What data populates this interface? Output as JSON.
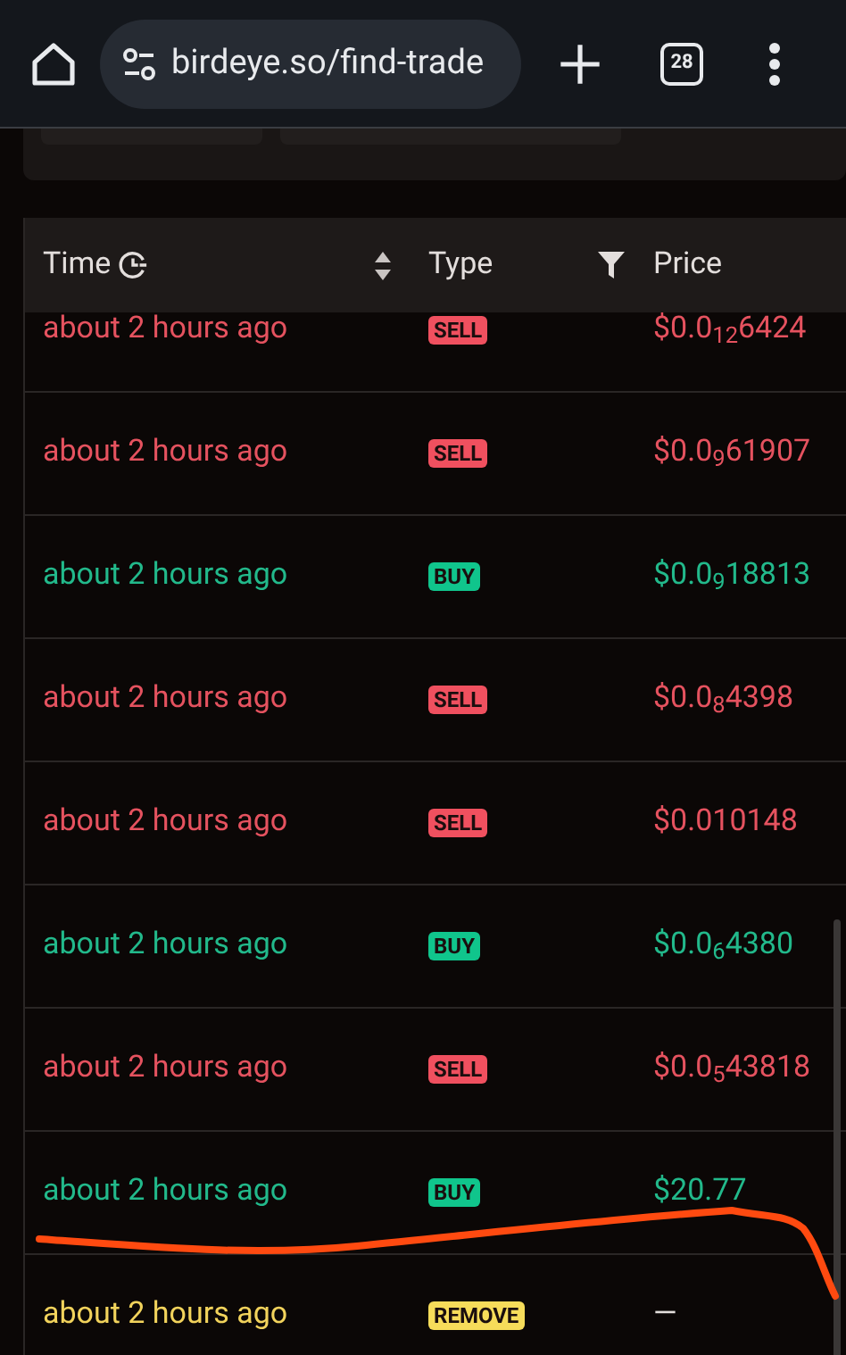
{
  "browser": {
    "url": "birdeye.so/find-trade",
    "tab_count": "28"
  },
  "table": {
    "columns": [
      {
        "label": "Time"
      },
      {
        "label": "Type"
      },
      {
        "label": "Price"
      }
    ],
    "rows": [
      {
        "time": "about 2 hours ago",
        "kind": "sell",
        "type": "SELL",
        "price": "$0.0$_{12}$6424"
      },
      {
        "time": "about 2 hours ago",
        "kind": "sell",
        "type": "SELL",
        "price": "$0.0$_{9}$61907"
      },
      {
        "time": "about 2 hours ago",
        "kind": "buy",
        "type": "BUY",
        "price": "$0.0$_{9}$18813"
      },
      {
        "time": "about 2 hours ago",
        "kind": "sell",
        "type": "SELL",
        "price": "$0.0$_{8}$4398"
      },
      {
        "time": "about 2 hours ago",
        "kind": "sell",
        "type": "SELL",
        "price": "$0.010148"
      },
      {
        "time": "about 2 hours ago",
        "kind": "buy",
        "type": "BUY",
        "price": "$0.0$_{6}$4380"
      },
      {
        "time": "about 2 hours ago",
        "kind": "sell",
        "type": "SELL",
        "price": "$0.0$_{5}$43818"
      },
      {
        "time": "about 2 hours ago",
        "kind": "buy",
        "type": "BUY",
        "price": "$20.77"
      },
      {
        "time": "about 2 hours ago",
        "kind": "remove",
        "type": "REMOVE",
        "price": "—"
      }
    ]
  }
}
